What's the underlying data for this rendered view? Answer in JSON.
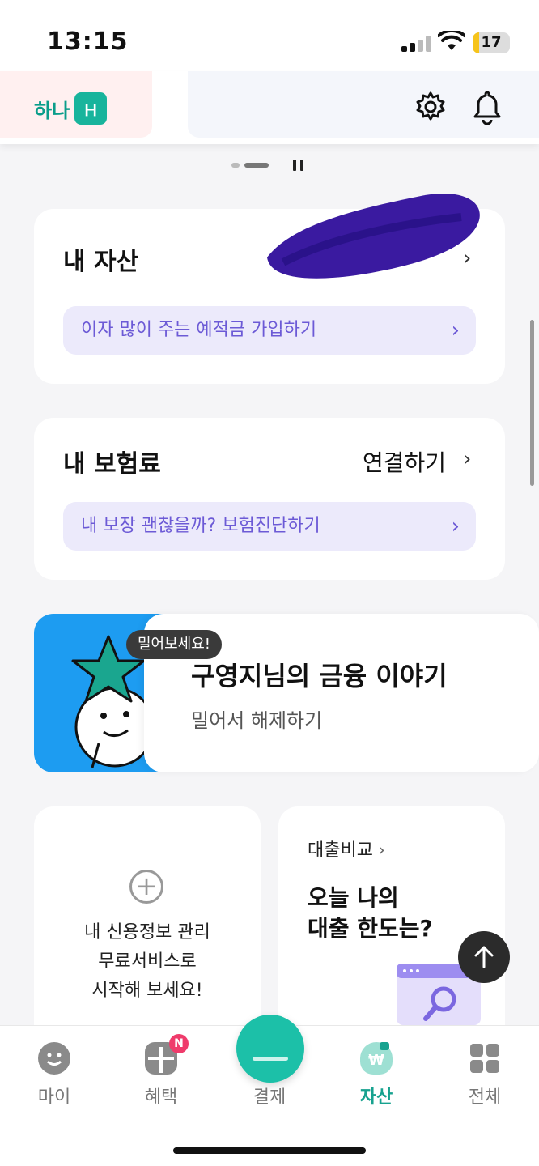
{
  "status_bar": {
    "time": "13:15",
    "battery": "17",
    "battery_fraction": 0.17
  },
  "header": {
    "logo_text": "하나",
    "logo_mark": "Ｈ",
    "icons": [
      "settings-icon",
      "bell-icon"
    ]
  },
  "assets_card": {
    "title": "내 자산",
    "promo": "이자 많이 주는 예적금 가입하기"
  },
  "insurance_card": {
    "title": "내 보험료",
    "link": "연결하기",
    "promo": "내 보장 괜찮을까? 보험진단하기"
  },
  "story": {
    "bubble": "밀어보세요!",
    "title": "구영지님의 금융 이야기",
    "subtitle": "밀어서 해제하기"
  },
  "credit_card": {
    "line1": "내 신용정보 관리",
    "line2": "무료서비스로",
    "line3": "시작해 보세요!"
  },
  "loan_card": {
    "category": "대출비교",
    "line1": "오늘 나의",
    "line2": "대출 한도는?"
  },
  "tabs": [
    {
      "label": "마이",
      "icon": "smile-face-icon"
    },
    {
      "label": "혜택",
      "icon": "gift-icon",
      "badge": "N"
    },
    {
      "label": "결제",
      "icon": "pay-icon"
    },
    {
      "label": "자산",
      "icon": "money-bag-icon",
      "active": true
    },
    {
      "label": "전체",
      "icon": "grid-icon"
    }
  ],
  "colors": {
    "accent": "#17a28f",
    "promo_text": "#6c5ad6",
    "promo_bg": "#eceafb",
    "story_blue": "#1d9cf1"
  }
}
